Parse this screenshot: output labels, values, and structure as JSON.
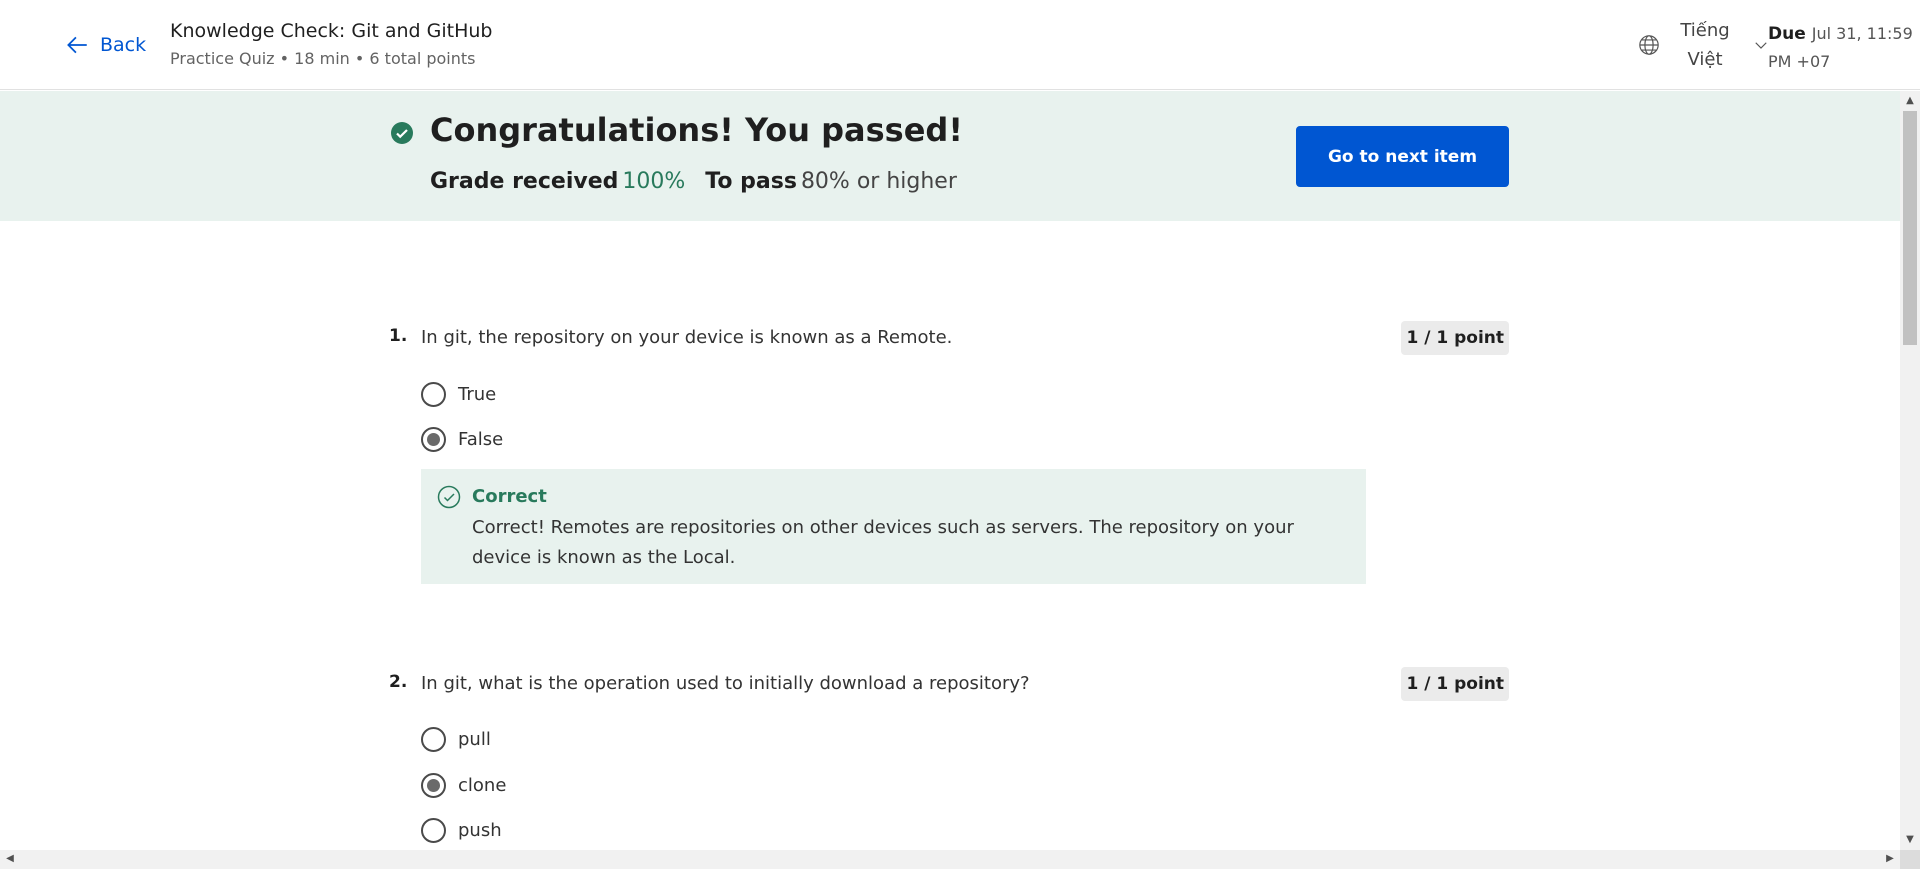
{
  "header": {
    "back_label": "Back",
    "title": "Knowledge Check: Git and GitHub",
    "subtitle": "Practice Quiz • 18 min • 6 total points",
    "language_line1": "Tiếng",
    "language_line2": "Việt",
    "due_label": "Due",
    "due_line1": "Jul 31, 11:59",
    "due_line2": "PM +07"
  },
  "banner": {
    "title": "Congratulations! You passed!",
    "grade_label": "Grade received",
    "grade_value": "100%",
    "pass_label": "To pass",
    "pass_value": "80% or higher",
    "next_button": "Go to next item"
  },
  "questions": [
    {
      "number": "1.",
      "text": "In git, the repository on your device is known as a Remote.",
      "points": "1 / 1 point",
      "options": [
        {
          "label": "True",
          "selected": false
        },
        {
          "label": "False",
          "selected": true
        }
      ],
      "feedback": {
        "title": "Correct",
        "text": "Correct! Remotes are repositories on other devices such as servers. The repository on your device is known as the Local."
      }
    },
    {
      "number": "2.",
      "text": "In git, what is the operation used to initially download a repository?",
      "points": "1 / 1 point",
      "options": [
        {
          "label": "pull",
          "selected": false
        },
        {
          "label": "clone",
          "selected": true
        },
        {
          "label": "push",
          "selected": false
        }
      ]
    }
  ],
  "colors": {
    "accent": "#0056d2",
    "success": "#287a5c",
    "banner_bg": "#e8f2ee"
  },
  "icons": {
    "back": "arrow-left-icon",
    "language": "globe-icon",
    "chevron": "chevron-down-icon",
    "pass": "check-circle-filled-icon",
    "feedback": "check-circle-outline-icon"
  }
}
